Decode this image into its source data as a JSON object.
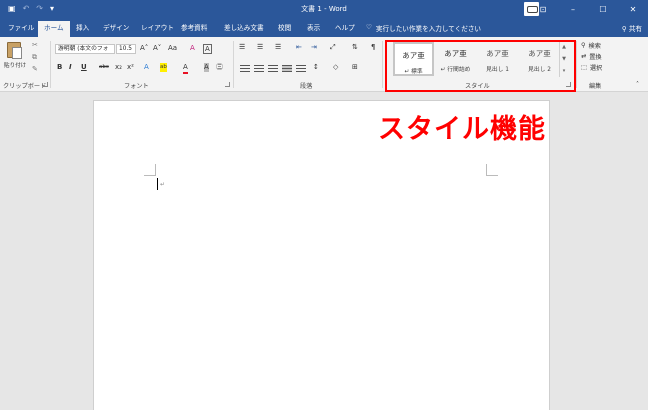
{
  "app": {
    "document_title": "文書 1 - Word"
  },
  "qat": {
    "save_icon": "save-icon",
    "undo_icon": "undo-icon",
    "redo_icon": "redo-icon",
    "customize_icon": "customize-icon"
  },
  "window_controls": {
    "ribbon_options_icon": "ribbon-display-icon",
    "minimize": "–",
    "maximize": "☐",
    "close": "✕"
  },
  "tabs": [
    "ファイル",
    "ホーム",
    "挿入",
    "デザイン",
    "レイアウト",
    "参考資料",
    "差し込み文書",
    "校閲",
    "表示",
    "ヘルプ"
  ],
  "tell_me": "実行したい作業を入力してください",
  "share": "共有",
  "clipboard": {
    "paste_label": "貼り付け",
    "group_label": "クリップボード"
  },
  "font": {
    "font_name": "游明朝 (本文のフォ",
    "font_size": "10.5",
    "group_label": "フォント",
    "row1": [
      "A˄",
      "A˅",
      "Aa",
      "A",
      "A"
    ],
    "row2": [
      "B",
      "I",
      "U",
      "abc",
      "x₂",
      "x²",
      "A",
      "ab",
      "A",
      "A",
      "㊂"
    ]
  },
  "paragraph": {
    "group_label": "段落"
  },
  "styles": {
    "group_label": "スタイル",
    "items": [
      {
        "sample": "あア亜",
        "name": "↵ 標準"
      },
      {
        "sample": "あア亜",
        "name": "↵ 行間詰め"
      },
      {
        "sample": "あア亜",
        "name": "見出し 1"
      },
      {
        "sample": "あア亜",
        "name": "見出し 2"
      }
    ]
  },
  "editing": {
    "group_label": "編集",
    "find": "検索",
    "replace": "置換",
    "select": "選択"
  },
  "annotation": {
    "text": "スタイル機能",
    "color": "#ff0000"
  },
  "colors": {
    "title_bar": "#2b579a",
    "ribbon": "#f3f3f3",
    "canvas": "#e6e6e6"
  }
}
